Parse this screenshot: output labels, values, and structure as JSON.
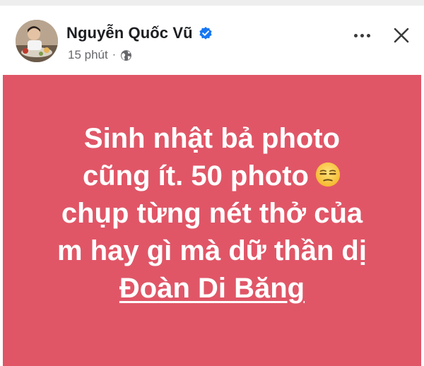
{
  "post": {
    "author_name": "Nguyễn Quốc Vũ",
    "timestamp": "15 phút",
    "separator": "·",
    "privacy_icon": "globe-icon",
    "verified_icon": "verified-badge-icon",
    "more_icon": "more-horizontal-icon",
    "close_icon": "close-icon",
    "background_color": "#e05667",
    "text_color": "#ffffff",
    "lines": [
      "Sinh nhật bả photo",
      "cũng ít. 50 photo",
      "chụp từng nét thở của",
      "m hay gì mà dữ thần dị"
    ],
    "emoji": "unamused-face-emoji",
    "mention": "Đoàn Di Băng"
  },
  "colors": {
    "verified_blue": "#1877f2",
    "meta_gray": "#65676b",
    "name_black": "#1c1e21"
  }
}
